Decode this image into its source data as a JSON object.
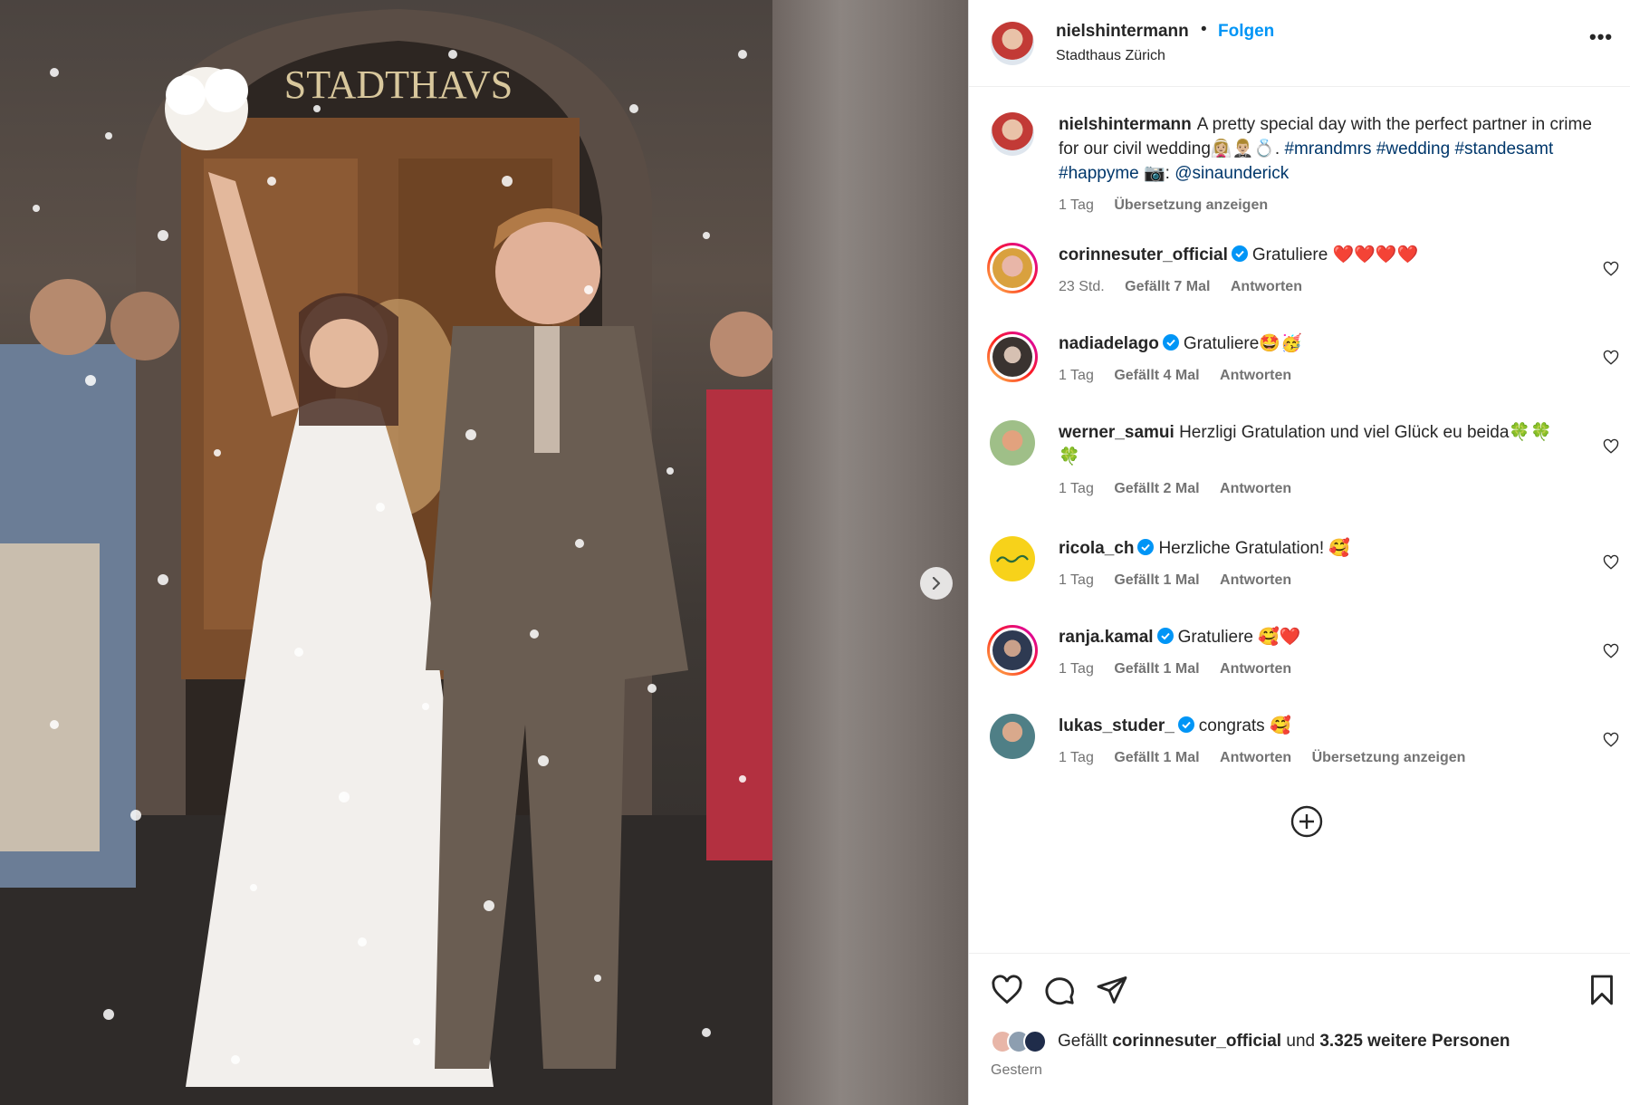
{
  "post": {
    "author": "nielshintermann",
    "separator": "•",
    "follow_label": "Folgen",
    "location": "Stadthaus Zürich",
    "more_label": "•••",
    "photo_sign": "STADTHAVS"
  },
  "caption": {
    "username": "nielshintermann",
    "text": "A pretty special day with the perfect partner in crime for our civil wedding👰🏼‍♀️🤵🏼‍♂️💍.",
    "tags": [
      "#mrandmrs",
      "#wedding",
      "#standesamt",
      "#happyme"
    ],
    "camera": "📷:",
    "mention": "@sinaunderick",
    "time": "1 Tag",
    "translate": "Übersetzung anzeigen"
  },
  "comments": [
    {
      "username": "corinnesuter_official",
      "verified": true,
      "text": "Gratuliere ❤️❤️❤️❤️",
      "time": "23 Std.",
      "likes": "Gefällt 7 Mal",
      "reply": "Antworten",
      "avatar_color": "#e8b6a8"
    },
    {
      "username": "nadiadelago",
      "verified": true,
      "text": "Gratuliere🤩🥳",
      "time": "1 Tag",
      "likes": "Gefällt 4 Mal",
      "reply": "Antworten",
      "avatar_color": "#3a3330"
    },
    {
      "username": "werner_samui",
      "verified": false,
      "text": "Herzligi Gratulation und viel Glück eu beida🍀🍀🍀",
      "time": "1 Tag",
      "likes": "Gefällt 2 Mal",
      "reply": "Antworten",
      "avatar_color": "#b9c7a4"
    },
    {
      "username": "ricola_ch",
      "verified": true,
      "text": "Herzliche Gratulation! 🥰",
      "time": "1 Tag",
      "likes": "Gefällt 1 Mal",
      "reply": "Antworten",
      "avatar_color": "#f7d21a"
    },
    {
      "username": "ranja.kamal",
      "verified": true,
      "text": "Gratuliere 🥰❤️",
      "time": "1 Tag",
      "likes": "Gefällt 1 Mal",
      "reply": "Antworten",
      "avatar_color": "#2e3a52"
    },
    {
      "username": "lukas_studer_",
      "verified": true,
      "text": "congrats 🥰",
      "time": "1 Tag",
      "likes": "Gefällt 1 Mal",
      "reply": "Antworten",
      "translate": "Übersetzung anzeigen",
      "avatar_color": "#4f7f86"
    }
  ],
  "likes_summary": {
    "prefix": "Gefällt",
    "first_user": "corinnesuter_official",
    "middle": "und",
    "count": "3.325 weitere Personen"
  },
  "date": "Gestern",
  "colors": {
    "link": "#0095f6",
    "tag": "#00376b",
    "verified": "#0095f6",
    "muted": "#737373"
  }
}
